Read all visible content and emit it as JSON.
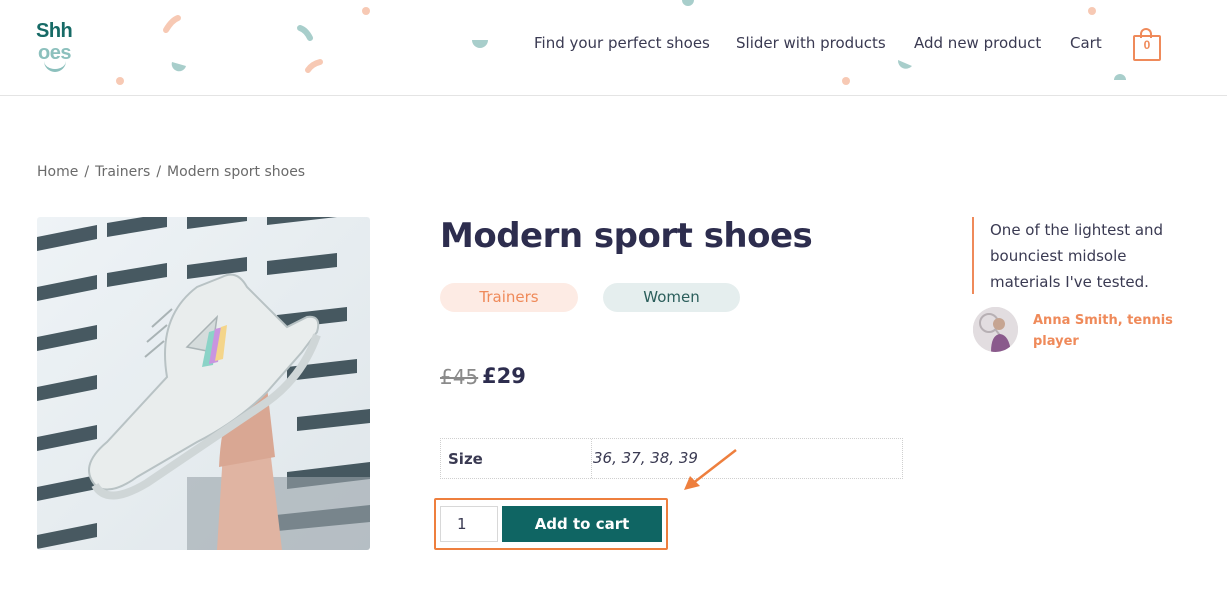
{
  "header": {
    "logo": {
      "line1": "Shh",
      "line2": "oes"
    },
    "nav": [
      {
        "label": "Find your perfect shoes"
      },
      {
        "label": "Slider with products"
      },
      {
        "label": "Add new product"
      },
      {
        "label": "Cart"
      }
    ],
    "cart_count": "0"
  },
  "breadcrumb": {
    "items": [
      "Home",
      "Trainers",
      "Modern sport shoes"
    ],
    "separator": "/"
  },
  "product": {
    "title": "Modern sport shoes",
    "tags": [
      "Trainers",
      "Women"
    ],
    "price_old": "£45",
    "price_new": "£29",
    "attribute": {
      "name": "Size",
      "value": "36, 37, 38, 39"
    },
    "quantity": "1",
    "add_to_cart_label": "Add to cart"
  },
  "testimonial": {
    "quote": "One of the lightest and bounciest midsole materials I've tested.",
    "author": "Anna Smith, tennis player"
  },
  "colors": {
    "accent": "#ef8a5a",
    "primary": "#0f6563",
    "text": "#2d2d4e",
    "annotation": "#ee7f3e"
  },
  "icons": {
    "cart": "shopping-bag-icon",
    "arrow": "annotation-arrow-icon"
  }
}
